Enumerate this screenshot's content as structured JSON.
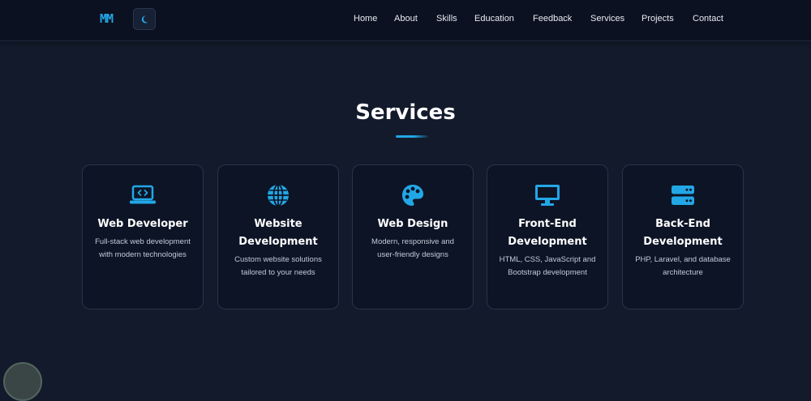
{
  "logo": "MM",
  "nav": {
    "items": [
      "Home",
      "About",
      "Skills",
      "Education",
      "Feedback",
      "Services",
      "Projects",
      "Contact"
    ]
  },
  "section": {
    "title": "Services"
  },
  "services": [
    {
      "title": "Web Developer",
      "description": "Full-stack web development with modern technologies",
      "icon": "laptop-code-icon"
    },
    {
      "title": "Website Development",
      "description": "Custom website solutions tailored to your needs",
      "icon": "globe-icon"
    },
    {
      "title": "Web Design",
      "description": "Modern, responsive and user-friendly designs",
      "icon": "palette-icon"
    },
    {
      "title": "Front-End Development",
      "description": "HTML, CSS, JavaScript and Bootstrap development",
      "icon": "desktop-icon"
    },
    {
      "title": "Back-End Development",
      "description": "PHP, Laravel, and database architecture",
      "icon": "server-icon"
    }
  ],
  "colors": {
    "accent": "#22a7e6",
    "background": "#121a2b",
    "navbar": "#0b1120",
    "card": "#0d1426"
  }
}
